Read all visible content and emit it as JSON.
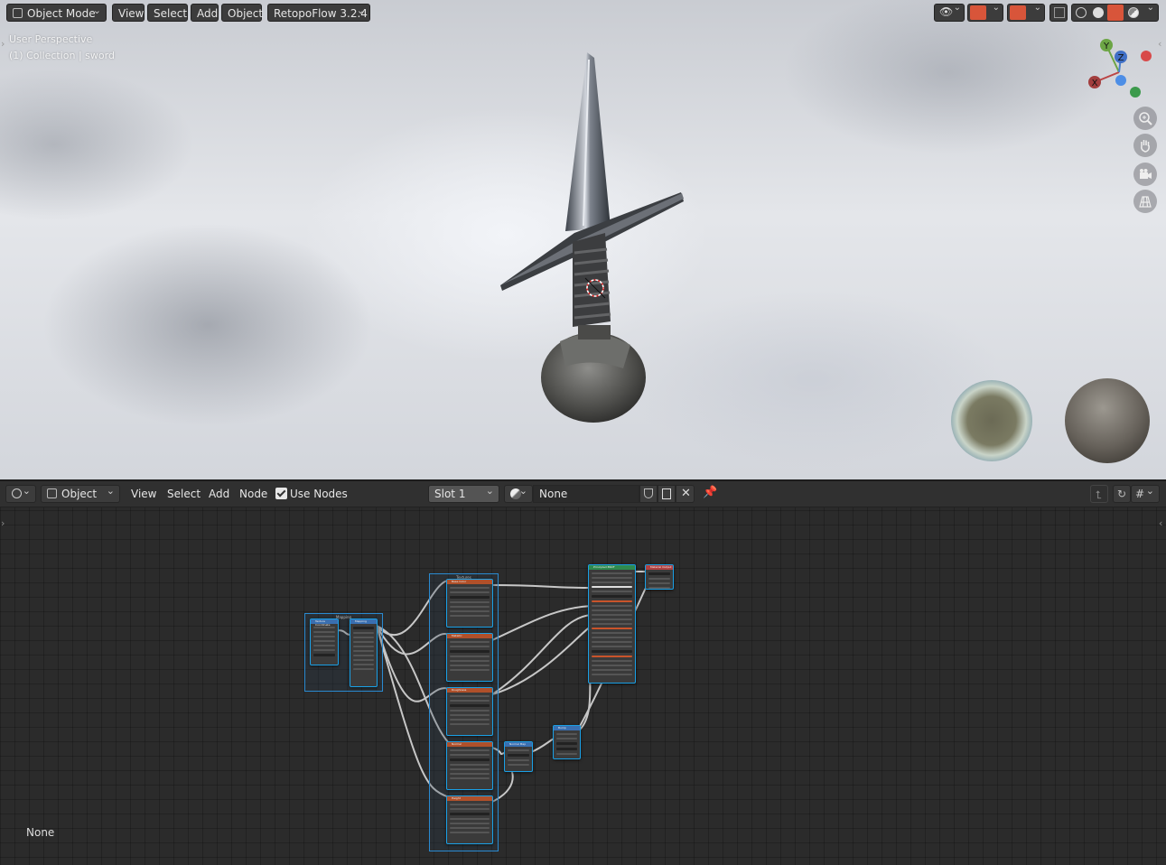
{
  "viewport": {
    "mode_label": "Object Mode",
    "menus": [
      "View",
      "Select",
      "Add",
      "Object"
    ],
    "addon_label": "RetopoFlow 3.2.4",
    "overlay_line1": "User Perspective",
    "overlay_line2": "(1) Collection | sword",
    "gizmo": {
      "x": "X",
      "y": "Y",
      "z": "Z"
    },
    "nav_icons": [
      "zoom-icon",
      "pan-hand-icon",
      "camera-icon",
      "grid-view-icon"
    ],
    "shading_icons": [
      "wireframe-shading-icon",
      "solid-shading-icon",
      "material-shading-icon",
      "rendered-shading-icon"
    ]
  },
  "node_editor": {
    "editor_type_icon": "shader-editor-icon",
    "object_label": "Object",
    "menus": [
      "View",
      "Select",
      "Add",
      "Node"
    ],
    "use_nodes_label": "Use Nodes",
    "use_nodes_checked": true,
    "slot_label": "Slot 1",
    "material_name": "None",
    "bottom_label": "None",
    "frames": {
      "left": "Mapping",
      "center": "Textures"
    },
    "nodes": {
      "tex_coord": "Texture Coordinate",
      "mapping": "Mapping",
      "tex1": "Base Color",
      "tex2": "Metallic",
      "tex3": "Roughness",
      "tex4": "Normal",
      "tex5": "Height",
      "normal_map": "Normal Map",
      "bump": "Bump",
      "principled": "Principled BSDF",
      "output": "Material Output"
    }
  },
  "colors": {
    "accent_blue": "#1aa0e6",
    "texture_header": "#b0502a",
    "bsdf_header": "#2f8a4e",
    "output_header": "#b04040",
    "vector_header": "#3a6fb0"
  }
}
